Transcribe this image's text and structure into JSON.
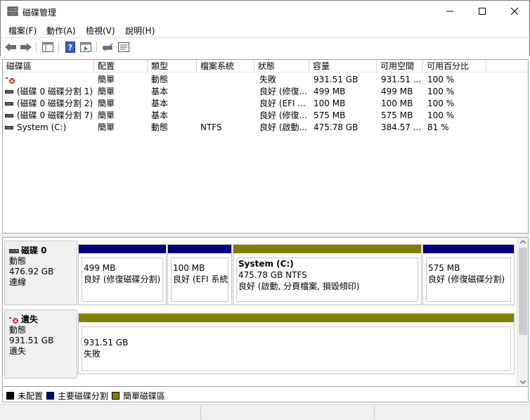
{
  "window": {
    "title": "磁碟管理"
  },
  "menu": [
    {
      "label": "檔案(F)"
    },
    {
      "label": "動作(A)"
    },
    {
      "label": "檢視(V)"
    },
    {
      "label": "說明(H)"
    }
  ],
  "toolbar": {
    "icons": [
      "back-arrow-icon",
      "forward-arrow-icon",
      "console-tree-icon",
      "help-icon",
      "action-pane-icon",
      "connect-disk-icon",
      "properties-icon"
    ]
  },
  "volume_list": {
    "columns": [
      "磁碟區",
      "配置",
      "類型",
      "檔案系統",
      "狀態",
      "容量",
      "可用空間",
      "可用百分比"
    ],
    "rows": [
      {
        "name": "",
        "layout": "簡單",
        "type": "動態",
        "fs": "",
        "status": "失敗",
        "capacity": "931.51 GB",
        "free": "931.51 ...",
        "pct": "100 %",
        "icon": "missing-disk-icon"
      },
      {
        "name": "(磁碟 0 磁碟分割 1)",
        "layout": "簡單",
        "type": "基本",
        "fs": "",
        "status": "良好 (修復...",
        "capacity": "499 MB",
        "free": "499 MB",
        "pct": "100 %",
        "icon": "volume-icon"
      },
      {
        "name": "(磁碟 0 磁碟分割 2)",
        "layout": "簡單",
        "type": "基本",
        "fs": "",
        "status": "良好 (EFI ...",
        "capacity": "100 MB",
        "free": "100 MB",
        "pct": "100 %",
        "icon": "volume-icon"
      },
      {
        "name": "(磁碟 0 磁碟分割 7)",
        "layout": "簡單",
        "type": "基本",
        "fs": "",
        "status": "良好 (修復...",
        "capacity": "575 MB",
        "free": "575 MB",
        "pct": "100 %",
        "icon": "volume-icon"
      },
      {
        "name": "System (C:)",
        "layout": "簡單",
        "type": "動態",
        "fs": "NTFS",
        "status": "良好 (啟動...",
        "capacity": "475.78 GB",
        "free": "384.57 ...",
        "pct": "81 %",
        "icon": "volume-icon"
      }
    ]
  },
  "disks": [
    {
      "name": "磁碟 0",
      "type": "動態",
      "size": "476.92 GB",
      "state": "連線",
      "icon": "disk-icon",
      "partitions": [
        {
          "title": "",
          "size": "499 MB",
          "status": "良好 (修復磁碟分割)",
          "kind": "primary"
        },
        {
          "title": "",
          "size": "100 MB",
          "status": "良好 (EFI 系統磁",
          "kind": "primary"
        },
        {
          "title": "System (C:)",
          "size": "475.78 GB NTFS",
          "status": "良好 (啟動, 分頁檔案, 損毀傾印)",
          "kind": "simple"
        },
        {
          "title": "",
          "size": "575 MB",
          "status": "良好 (修復磁碟分割)",
          "kind": "primary"
        }
      ]
    },
    {
      "name": "遺失",
      "type": "動態",
      "size": "931.51 GB",
      "state": "遺失",
      "icon": "missing-disk-icon",
      "partitions": [
        {
          "title": "",
          "size": "931.51 GB",
          "status": "失敗",
          "kind": "simple"
        }
      ]
    }
  ],
  "legend": [
    {
      "label": "未配置",
      "color": "#000000"
    },
    {
      "label": "主要磁碟分割",
      "color": "#000080"
    },
    {
      "label": "簡單磁碟區",
      "color": "#808000"
    }
  ],
  "colors": {
    "primary": "#000080",
    "simple": "#808000",
    "unallocated": "#000000",
    "error": "#c42b1c"
  }
}
